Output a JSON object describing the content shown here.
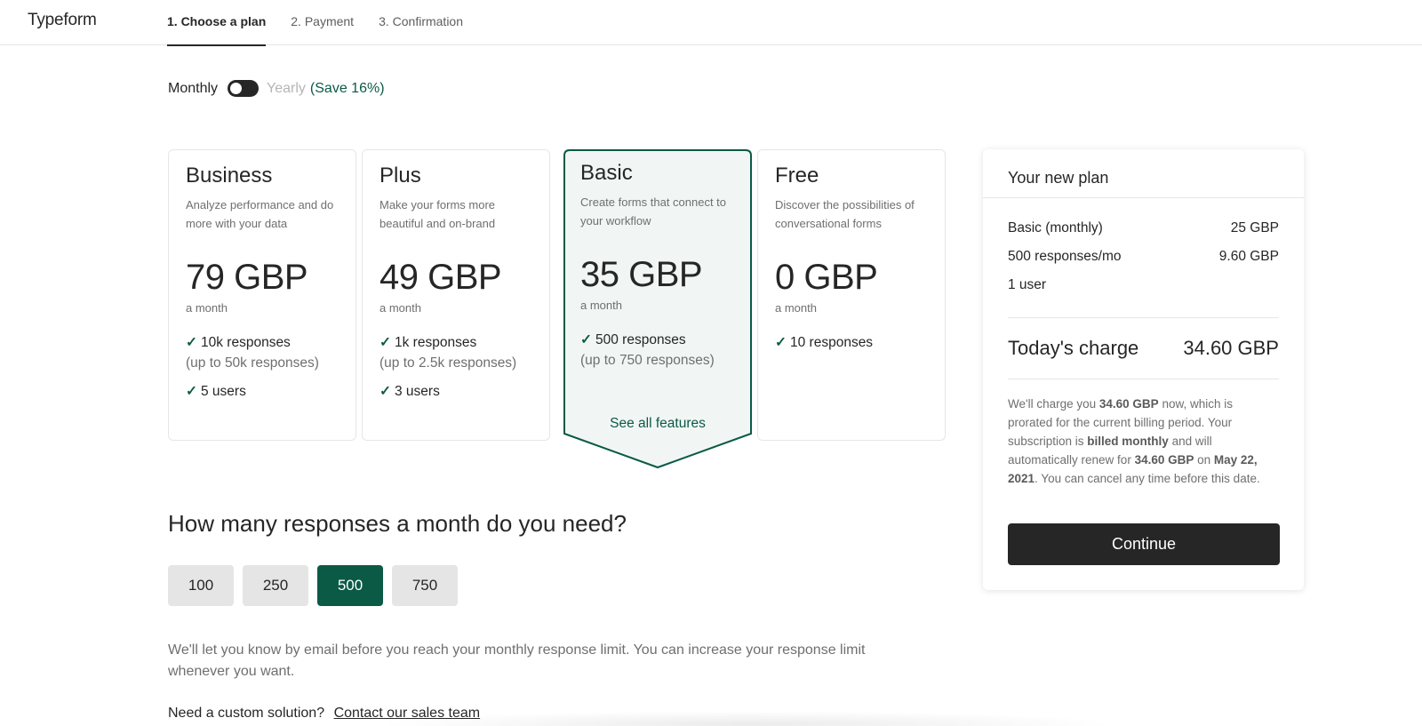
{
  "app": {
    "logo": "Typeform"
  },
  "steps": [
    {
      "label": "1. Choose a plan",
      "active": true
    },
    {
      "label": "2. Payment",
      "active": false
    },
    {
      "label": "3. Confirmation",
      "active": false
    }
  ],
  "billing": {
    "monthly_label": "Monthly",
    "yearly_label": "Yearly",
    "save_label": "(Save 16%)",
    "selected": "Monthly"
  },
  "plans": [
    {
      "name": "Business",
      "description": "Analyze performance and do more with your data",
      "price": "79 GBP",
      "period": "a month",
      "features": [
        {
          "text": "10k responses",
          "sub": "(up to 50k responses)"
        },
        {
          "text": "5 users"
        }
      ]
    },
    {
      "name": "Plus",
      "description": "Make your forms more beautiful and on-brand",
      "price": "49 GBP",
      "period": "a month",
      "features": [
        {
          "text": "1k responses",
          "sub": "(up to 2.5k responses)"
        },
        {
          "text": "3 users"
        }
      ]
    },
    {
      "name": "Basic",
      "description": "Create forms that connect to your workflow",
      "price": "35 GBP",
      "period": "a month",
      "selected": true,
      "features": [
        {
          "text": "500 responses",
          "sub": "(up to 750 responses)"
        }
      ],
      "see_all": "See all features"
    },
    {
      "name": "Free",
      "description": "Discover the possibilities of conversational forms",
      "price": "0 GBP",
      "period": "a month",
      "features": [
        {
          "text": "10 responses"
        }
      ]
    }
  ],
  "responses": {
    "question": "How many responses a month do you need?",
    "options": [
      "100",
      "250",
      "500",
      "750"
    ],
    "selected": "500",
    "note": "We'll let you know by email before you reach your monthly response limit. You can increase your response limit whenever you want."
  },
  "custom": {
    "text": "Need a custom solution?",
    "link": "Contact our sales team"
  },
  "summary": {
    "title": "Your new plan",
    "lines": [
      {
        "label": "Basic (monthly)",
        "value": "25 GBP"
      },
      {
        "label": "500 responses/mo",
        "value": "9.60 GBP"
      },
      {
        "label": "1 user",
        "value": ""
      }
    ],
    "charge_label": "Today's charge",
    "charge_value": "34.60 GBP",
    "fineprint": {
      "p1": "We'll charge you ",
      "amount_now": "34.60 GBP",
      "p2": " now, which is prorated for the current billing period. Your subscription is ",
      "billing": "billed monthly",
      "p3": " and will automatically renew for ",
      "amount_renew": "34.60 GBP",
      "p4": " on ",
      "date": "May 22, 2021",
      "p5": ". You can cancel any time before this date."
    },
    "continue_label": "Continue"
  },
  "colors": {
    "brand_green": "#0b5a46",
    "dark": "#262627",
    "selected_card_bg": "#f1f6f4"
  }
}
